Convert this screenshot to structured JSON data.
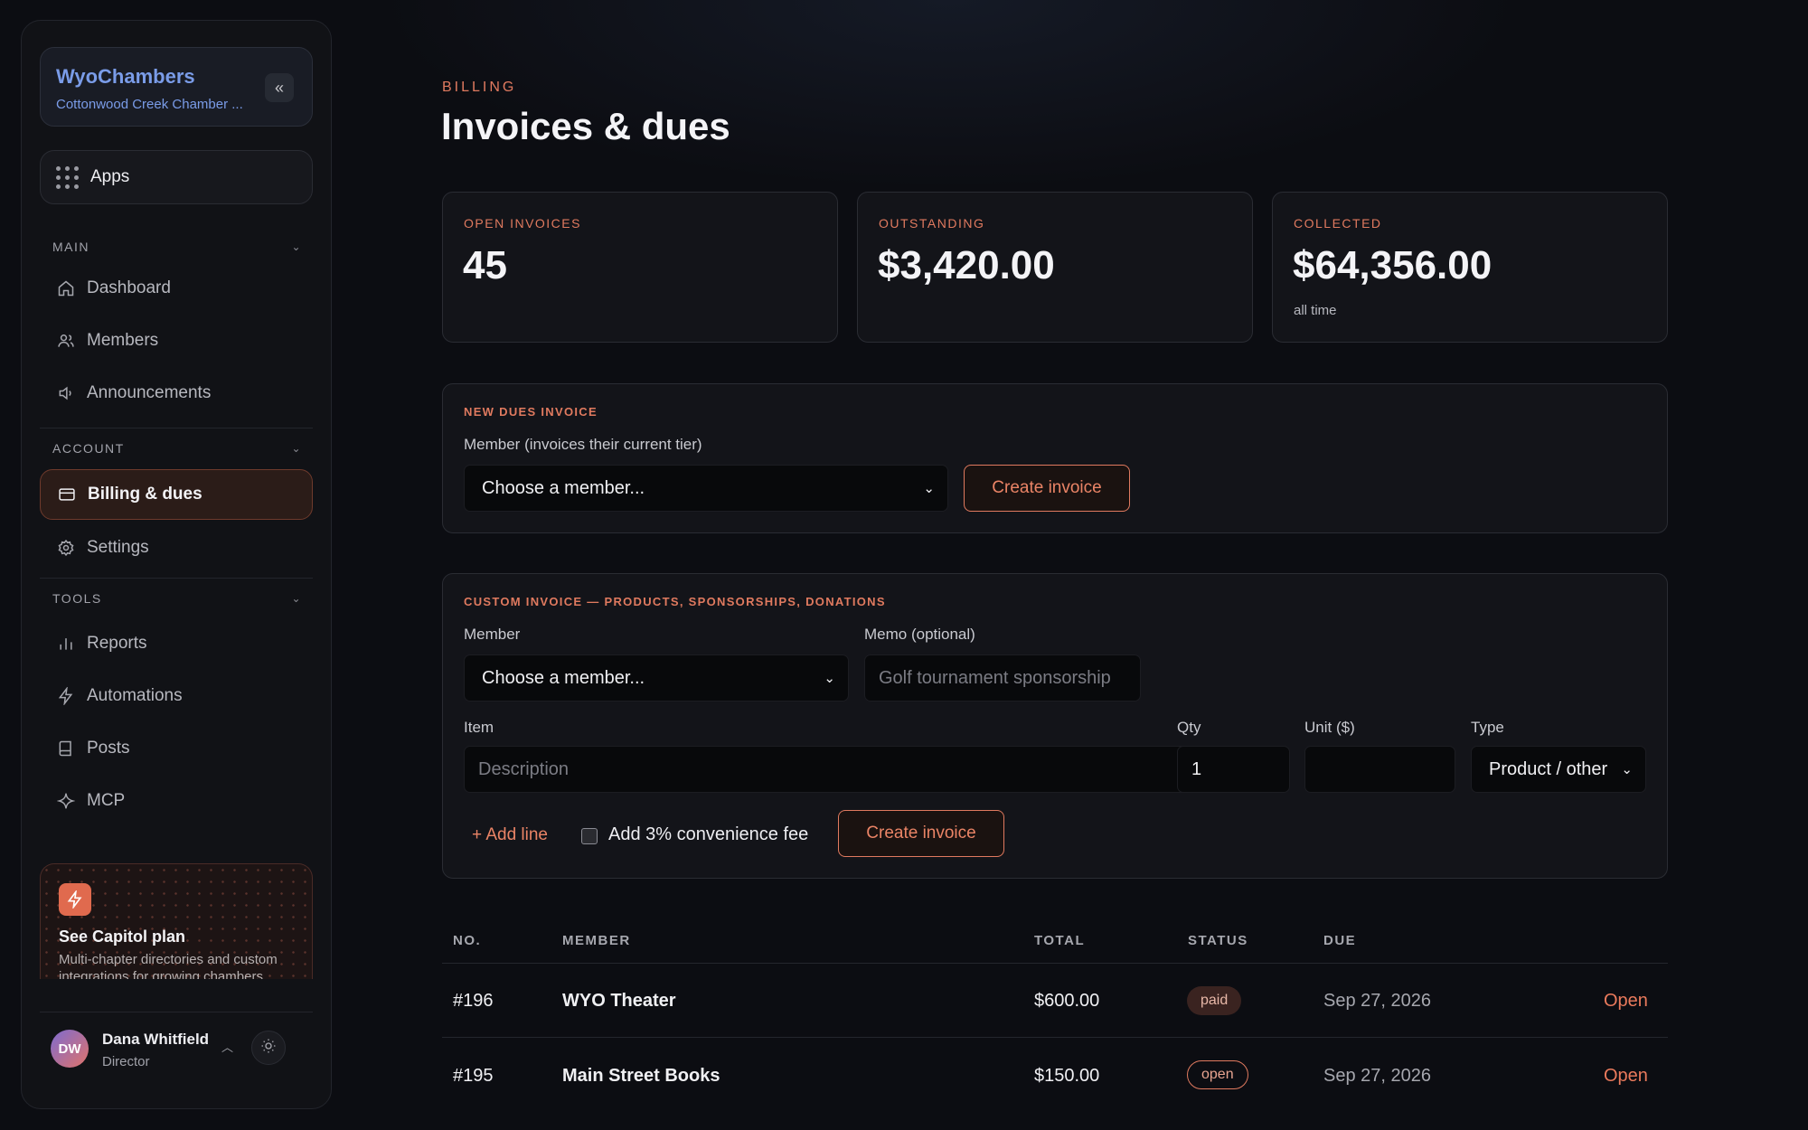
{
  "sidebar": {
    "brand_name": "WyoChambers",
    "brand_sub": "Cottonwood Creek Chamber ...",
    "apps_label": "Apps",
    "sections": {
      "main": "MAIN",
      "account": "ACCOUNT",
      "tools": "TOOLS"
    },
    "items": {
      "dashboard": "Dashboard",
      "members": "Members",
      "announcements": "Announcements",
      "billing": "Billing & dues",
      "settings": "Settings",
      "reports": "Reports",
      "automations": "Automations",
      "posts": "Posts",
      "mcp": "MCP"
    },
    "promo": {
      "title": "See Capitol plan",
      "desc": "Multi-chapter directories and custom integrations for growing chambers."
    },
    "user": {
      "initials": "DW",
      "name": "Dana Whitfield",
      "role": "Director"
    }
  },
  "header": {
    "eyebrow": "BILLING",
    "title": "Invoices & dues"
  },
  "stats": [
    {
      "label": "OPEN INVOICES",
      "value": "45",
      "note": ""
    },
    {
      "label": "OUTSTANDING",
      "value": "$3,420.00",
      "note": ""
    },
    {
      "label": "COLLECTED",
      "value": "$64,356.00",
      "note": "all time"
    }
  ],
  "dues_form": {
    "title": "NEW DUES INVOICE",
    "member_label": "Member (invoices their current tier)",
    "member_value": "Choose a member...",
    "create_label": "Create invoice"
  },
  "custom_form": {
    "title": "CUSTOM INVOICE — PRODUCTS, SPONSORSHIPS, DONATIONS",
    "member_label": "Member",
    "member_value": "Choose a member...",
    "memo_label": "Memo (optional)",
    "memo_placeholder": "Golf tournament sponsorship",
    "item_label": "Item",
    "item_placeholder": "Description",
    "qty_label": "Qty",
    "qty_value": "1",
    "unit_label": "Unit ($)",
    "unit_value": "",
    "type_label": "Type",
    "type_value": "Product / other",
    "add_line": "+ Add line",
    "fee_label": "Add 3% convenience fee",
    "create_label": "Create invoice"
  },
  "table": {
    "columns": [
      "NO.",
      "MEMBER",
      "TOTAL",
      "STATUS",
      "DUE"
    ],
    "rows": [
      {
        "no": "#196",
        "member": "WYO Theater",
        "total": "$600.00",
        "status": "paid",
        "due": "Sep 27, 2026",
        "action": "Open"
      },
      {
        "no": "#195",
        "member": "Main Street Books",
        "total": "$150.00",
        "status": "open",
        "due": "Sep 27, 2026",
        "action": "Open"
      }
    ]
  },
  "colors": {
    "accent": "#e07a5f",
    "brand": "#7a9ce8",
    "background": "#0c0d12"
  }
}
